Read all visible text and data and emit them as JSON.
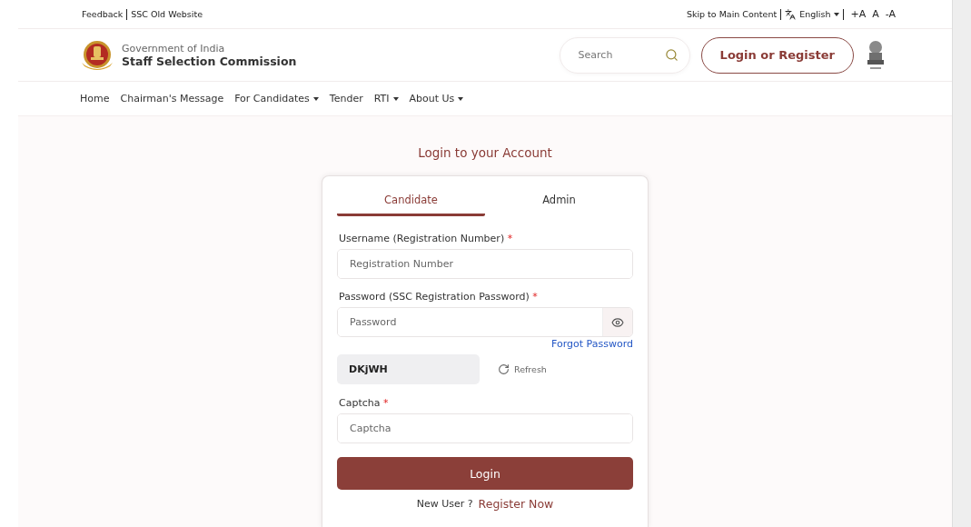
{
  "top_bar": {
    "left_links": [
      "Feedback",
      "SSC Old Website"
    ],
    "skip_link": "Skip to Main Content",
    "language": "English",
    "font_sizes": [
      "+A",
      "A",
      "-A"
    ]
  },
  "header": {
    "org_parent": "Government of India",
    "org_name": "Staff Selection Commission",
    "search": {
      "placeholder": "Search"
    },
    "login_button": "Login or Register"
  },
  "nav": [
    {
      "label": "Home",
      "has_menu": false
    },
    {
      "label": "Chairman's Message",
      "has_menu": false
    },
    {
      "label": "For Candidates",
      "has_menu": true
    },
    {
      "label": "Tender",
      "has_menu": false
    },
    {
      "label": "RTI",
      "has_menu": true
    },
    {
      "label": "About Us",
      "has_menu": true
    }
  ],
  "login": {
    "title": "Login to your Account",
    "tabs": [
      {
        "label": "Candidate",
        "selected": true
      },
      {
        "label": "Admin",
        "selected": false
      }
    ],
    "username": {
      "label": "Username (Registration Number)",
      "required_mark": "*",
      "placeholder": "Registration Number"
    },
    "password": {
      "label": "Password (SSC Registration Password)",
      "required_mark": "*",
      "placeholder": "Password"
    },
    "forgot_link": "Forgot Password",
    "captcha_code": "DKjWH",
    "refresh": "Refresh",
    "captcha": {
      "label": "Captcha",
      "required_mark": "*",
      "placeholder": "Captcha"
    },
    "submit": "Login",
    "new_user": "New User ?",
    "register_link": "Register Now"
  }
}
